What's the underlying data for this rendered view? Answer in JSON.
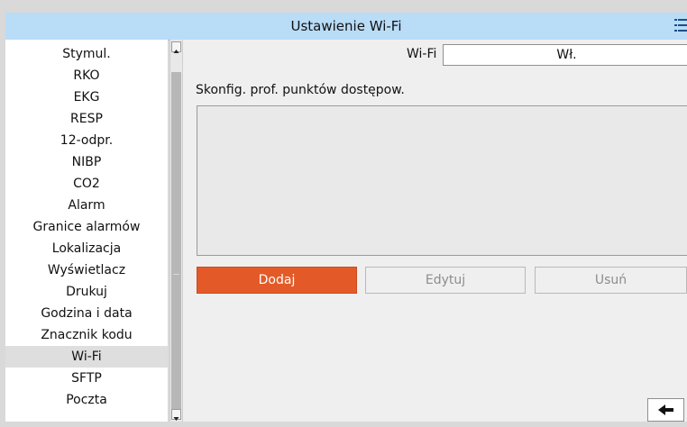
{
  "header": {
    "title": "Ustawienie Wi-Fi",
    "menu_icon": "list-menu-icon"
  },
  "sidebar": {
    "items": [
      {
        "label": "Stymul."
      },
      {
        "label": "RKO"
      },
      {
        "label": "EKG"
      },
      {
        "label": "RESP"
      },
      {
        "label": "12-odpr."
      },
      {
        "label": "NIBP"
      },
      {
        "label": "CO2"
      },
      {
        "label": "Alarm"
      },
      {
        "label": "Granice alarmów"
      },
      {
        "label": "Lokalizacja"
      },
      {
        "label": "Wyświetlacz"
      },
      {
        "label": "Drukuj"
      },
      {
        "label": "Godzina i data"
      },
      {
        "label": "Znacznik kodu"
      },
      {
        "label": "Wi-Fi"
      },
      {
        "label": "SFTP"
      },
      {
        "label": "Poczta"
      }
    ],
    "selected": "Wi-Fi"
  },
  "main": {
    "wifi_label": "Wi-Fi",
    "wifi_value": "Wł.",
    "config_label": "Skonfig. prof. punktów dostępow.",
    "buttons": {
      "add": "Dodaj",
      "edit": "Edytuj",
      "delete": "Usuń"
    }
  },
  "colors": {
    "header": "#b9dcf7",
    "primary_button": "#e35a28",
    "selected_row": "#dedede"
  },
  "icons": {
    "back": "back-arrow-icon",
    "scroll_up": "scroll-up-arrow-icon",
    "scroll_down": "scroll-down-arrow-icon"
  }
}
